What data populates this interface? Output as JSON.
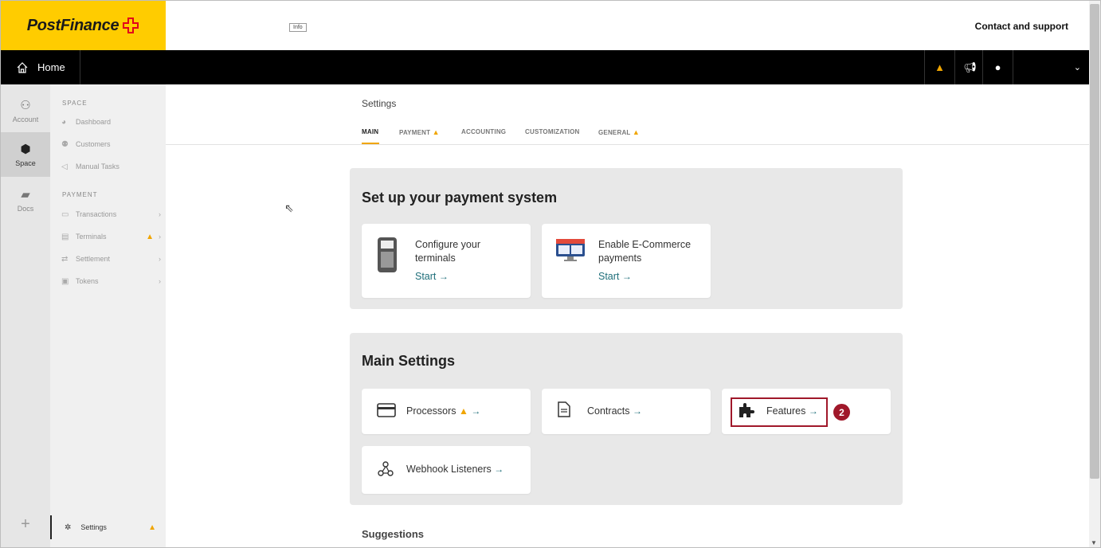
{
  "header": {
    "logo_text": "PostFinance",
    "info_label": "Info",
    "contact_label": "Contact and support"
  },
  "nav": {
    "home_label": "Home",
    "icons": [
      "warning-icon",
      "megaphone-icon",
      "globe-icon",
      "chevron-down-icon"
    ]
  },
  "rail": {
    "items": [
      {
        "label": "Account",
        "icon": "account-icon"
      },
      {
        "label": "Space",
        "icon": "space-icon",
        "active": true
      },
      {
        "label": "Docs",
        "icon": "docs-icon"
      }
    ]
  },
  "sidemenu": {
    "space_title": "SPACE",
    "space_items": [
      "Dashboard",
      "Customers",
      "Manual Tasks"
    ],
    "payment_title": "PAYMENT",
    "payment_items": [
      "Transactions",
      "Terminals",
      "Settlement",
      "Tokens"
    ],
    "settings_label": "Settings"
  },
  "page": {
    "title": "Settings",
    "tabs": [
      "MAIN",
      "PAYMENT",
      "ACCOUNTING",
      "CUSTOMIZATION",
      "GENERAL"
    ],
    "active_tab": "MAIN"
  },
  "setup": {
    "title": "Set up your payment system",
    "cards": [
      {
        "label_line1": "Configure your",
        "label_line2": "terminals",
        "link": "Start"
      },
      {
        "label_line1": "Enable E-Commerce",
        "label_line2": "payments",
        "link": "Start"
      }
    ]
  },
  "main_settings": {
    "title": "Main Settings",
    "cards": [
      "Processors",
      "Contracts",
      "Features",
      "Webhook Listeners"
    ]
  },
  "step_badge": "2",
  "suggestions_title": "Suggestions",
  "colors": {
    "brand": "#ffcc00",
    "accent": "#f0a500",
    "link": "#1f6f7a",
    "highlight": "#a0182a"
  }
}
